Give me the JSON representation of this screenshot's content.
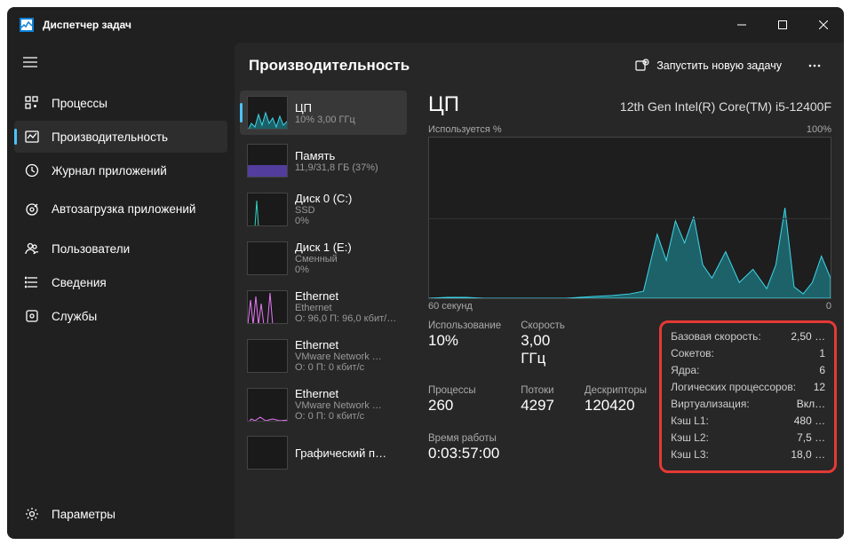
{
  "app_title": "Диспетчер задач",
  "sidebar": {
    "items": [
      {
        "label": "Процессы"
      },
      {
        "label": "Производительность"
      },
      {
        "label": "Журнал приложений"
      },
      {
        "label": "Автозагрузка приложений"
      },
      {
        "label": "Пользователи"
      },
      {
        "label": "Сведения"
      },
      {
        "label": "Службы"
      }
    ],
    "settings": "Параметры"
  },
  "header": {
    "title": "Производительность",
    "run_task": "Запустить новую задачу"
  },
  "resources": [
    {
      "name": "ЦП",
      "sub": "10% 3,00 ГГц"
    },
    {
      "name": "Память",
      "sub": "11,9/31,8 ГБ (37%)"
    },
    {
      "name": "Диск 0 (C:)",
      "sub": "SSD",
      "sub2": "0%"
    },
    {
      "name": "Диск 1 (E:)",
      "sub": "Сменный",
      "sub2": "0%"
    },
    {
      "name": "Ethernet",
      "sub": "Ethernet",
      "sub2": "О: 96,0 П: 96,0 кбит/…"
    },
    {
      "name": "Ethernet",
      "sub": "VMware Network …",
      "sub2": "О: 0 П: 0 кбит/с"
    },
    {
      "name": "Ethernet",
      "sub": "VMware Network …",
      "sub2": "О: 0 П: 0 кбит/с"
    },
    {
      "name": "Графический п…",
      "sub": ""
    }
  ],
  "detail": {
    "title": "ЦП",
    "model": "12th Gen Intel(R) Core(TM) i5-12400F",
    "usage_label": "Используется %",
    "usage_max": "100%",
    "x_left": "60 секунд",
    "x_right": "0",
    "stats": {
      "usage_l": "Использование",
      "usage_v": "10%",
      "speed_l": "Скорость",
      "speed_v": "3,00 ГГц",
      "proc_l": "Процессы",
      "proc_v": "260",
      "thread_l": "Потоки",
      "thread_v": "4297",
      "hnd_l": "Дескрипторы",
      "hnd_v": "120420",
      "uptime_l": "Время работы",
      "uptime_v": "0:03:57:00"
    },
    "info": [
      {
        "k": "Базовая скорость:",
        "v": "2,50 …"
      },
      {
        "k": "Сокетов:",
        "v": "1"
      },
      {
        "k": "Ядра:",
        "v": "6"
      },
      {
        "k": "Логических процессоров:",
        "v": "12"
      },
      {
        "k": "Виртуализация:",
        "v": "Вкл…"
      },
      {
        "k": "Кэш L1:",
        "v": "480 …"
      },
      {
        "k": "Кэш L2:",
        "v": "7,5 …"
      },
      {
        "k": "Кэш L3:",
        "v": "18,0 …"
      }
    ]
  }
}
